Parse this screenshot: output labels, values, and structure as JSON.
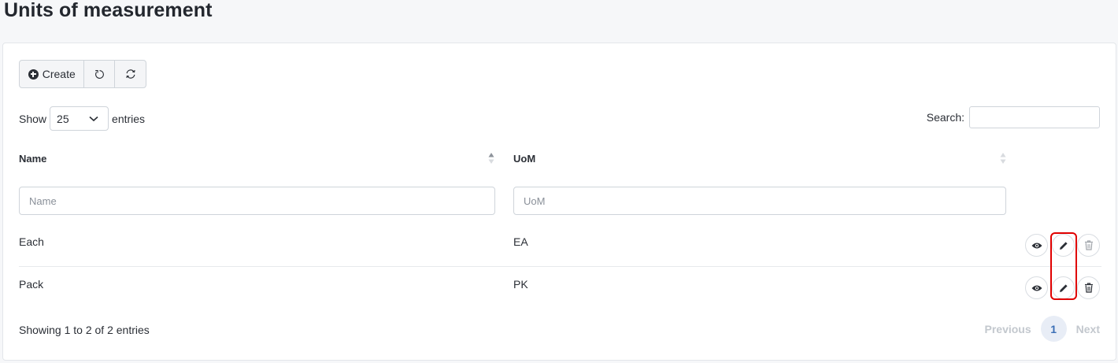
{
  "page": {
    "title": "Units of measurement"
  },
  "toolbar": {
    "create_label": "Create",
    "reset_icon": "reset-icon",
    "refresh_icon": "refresh-icon"
  },
  "length": {
    "show_label": "Show",
    "selected": "25",
    "entries_label": "entries"
  },
  "search": {
    "label": "Search:",
    "value": ""
  },
  "table": {
    "columns": [
      {
        "label": "Name",
        "filter_placeholder": "Name"
      },
      {
        "label": "UoM",
        "filter_placeholder": "UoM"
      }
    ],
    "rows": [
      {
        "name": "Each",
        "uom": "EA"
      },
      {
        "name": "Pack",
        "uom": "PK"
      }
    ]
  },
  "footer": {
    "info": "Showing 1 to 2 of 2 entries"
  },
  "pagination": {
    "previous": "Previous",
    "current": "1",
    "next": "Next"
  },
  "colors": {
    "highlight": "#e00000",
    "current_page": "#3b6fb6"
  }
}
